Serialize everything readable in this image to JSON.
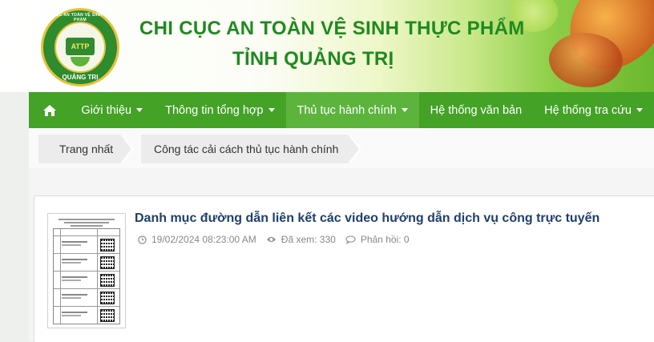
{
  "header": {
    "logo": {
      "top_text": "CHI CỤC AN TOÀN VỆ SINH THỰC PHẨM",
      "badge": "ATTP",
      "bottom_text": "QUẢNG TRỊ"
    },
    "title_line1": "CHI CỤC AN TOÀN VỆ SINH THỰC PHẨM",
    "title_line2": "TỈNH QUẢNG TRỊ"
  },
  "nav": {
    "home_icon": "home-icon",
    "items": [
      {
        "label": "Giới thiệu",
        "has_dropdown": true,
        "active": false
      },
      {
        "label": "Thông tin tổng hợp",
        "has_dropdown": true,
        "active": false
      },
      {
        "label": "Thủ tục hành chính",
        "has_dropdown": true,
        "active": true
      },
      {
        "label": "Hệ thống văn bản",
        "has_dropdown": false,
        "active": false
      },
      {
        "label": "Hệ thống tra cứu",
        "has_dropdown": true,
        "active": false
      }
    ]
  },
  "breadcrumb": [
    {
      "label": "Trang nhất"
    },
    {
      "label": "Công tác cải cách thủ tục hành chính"
    }
  ],
  "post": {
    "title": "Danh mục đường dẫn liên kết các video hướng dẫn dịch vụ công trực tuyến",
    "date": "19/02/2024 08:23:00 AM",
    "views": "Đã xem: 330",
    "replies": "Phản hồi: 0"
  },
  "colors": {
    "nav_bg": "#44a226",
    "nav_active": "#5cb43d",
    "title_green": "#1f8a1f",
    "post_title": "#1f3f6b"
  }
}
